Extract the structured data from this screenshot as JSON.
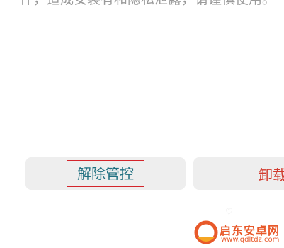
{
  "page": {
    "description_text": "件，造成安装有和隐私泄露，请谨慎使用。"
  },
  "buttons": {
    "unlock_label": "解除管控",
    "uninstall_label": "卸载"
  },
  "watermark": {
    "title": "启东安卓网",
    "url": "www.qdltdz.com"
  },
  "colors": {
    "button_bg": "#eeeeee",
    "unlock_text": "#1f6f80",
    "highlight_border": "#d4242b",
    "uninstall_text": "#d23a2e",
    "watermark_orange": "#e8592a"
  }
}
